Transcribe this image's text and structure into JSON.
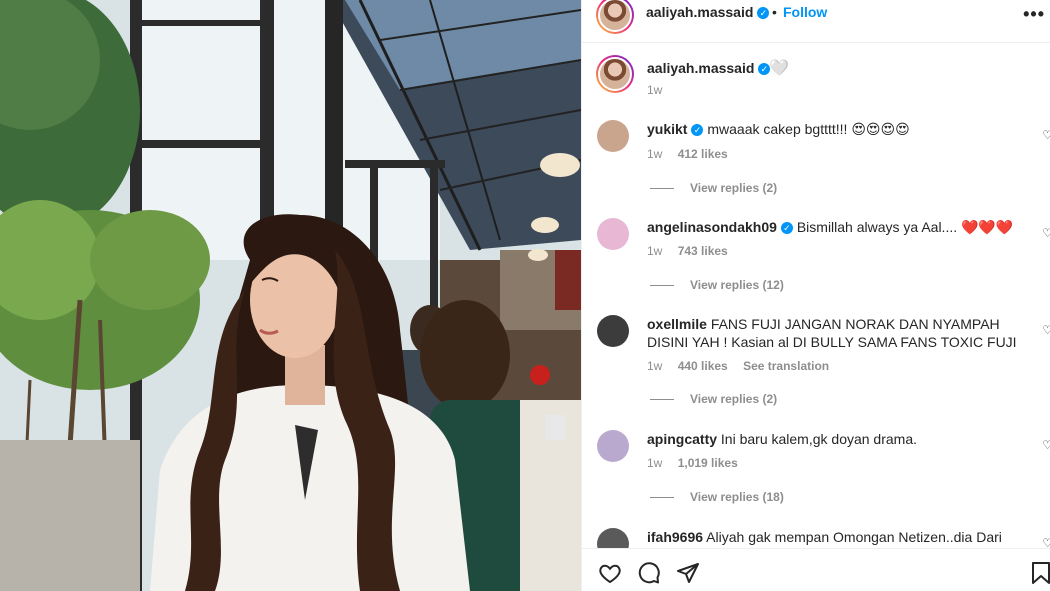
{
  "post": {
    "author": "aaliyah.massaid",
    "dot": "•",
    "follow_label": "Follow",
    "more_label": "•••"
  },
  "caption": {
    "author": "aaliyah.massaid",
    "emoji": "🤍",
    "time": "1w"
  },
  "comments": [
    {
      "username": "yukikt",
      "verified": true,
      "text": "mwaaak cakep bgtttt!!! 😍😍😍😍",
      "time": "1w",
      "likes": "412 likes",
      "translate": "",
      "replies": "View replies (2)",
      "avatar_color": "#c9a58e"
    },
    {
      "username": "angelinasondakh09",
      "verified": true,
      "text": "Bismillah always ya Aal.... ❤️❤️❤️",
      "time": "1w",
      "likes": "743 likes",
      "translate": "",
      "replies": "View replies (12)",
      "avatar_color": "#e8b7d4"
    },
    {
      "username": "oxellmile",
      "verified": false,
      "text": "FANS FUJI JANGAN NORAK DAN NYAMPAH DISINI YAH ! Kasian al DI BULLY SAMA FANS TOXIC FUJI",
      "time": "1w",
      "likes": "440 likes",
      "translate": "See translation",
      "replies": "View replies (2)",
      "avatar_color": "#3c3c3c"
    },
    {
      "username": "apingcatty",
      "verified": false,
      "text": "Ini baru kalem,gk doyan drama.",
      "time": "1w",
      "likes": "1,019 likes",
      "translate": "",
      "replies": "View replies (18)",
      "avatar_color": "#b9a9cf"
    },
    {
      "username": "ifah9696",
      "verified": false,
      "text": "Aliyah gak mempan Omongan Netizen..dia Dari",
      "time": "",
      "likes": "",
      "translate": "",
      "replies": "",
      "avatar_color": "#5a5a5a"
    }
  ],
  "actions": {
    "like_icon": "heart-outline-icon",
    "comment_icon": "comment-bubble-icon",
    "share_icon": "paper-plane-icon",
    "save_icon": "bookmark-icon"
  },
  "colors": {
    "accent": "#0095f6",
    "muted": "#8e8e8e",
    "text": "#262626"
  }
}
